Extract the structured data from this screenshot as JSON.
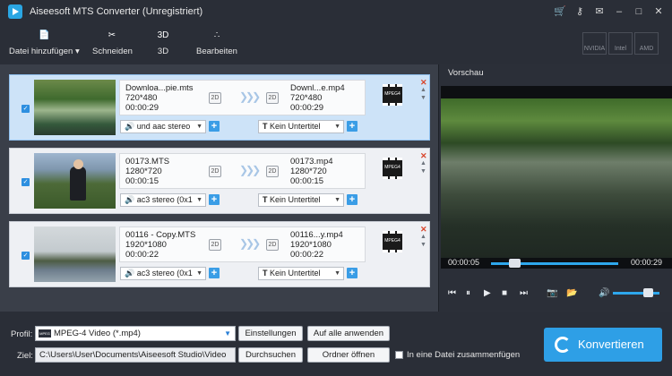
{
  "window": {
    "title": "Aiseesoft MTS Converter (Unregistriert)",
    "controls": [
      "⌘",
      "♪",
      "≡",
      "–",
      "□",
      "✕"
    ]
  },
  "toolbar": {
    "add_file": "Datei hinzufügen",
    "cut": "Schneiden",
    "three_d": "3D",
    "edit": "Bearbeiten",
    "three_d_icon_text": "3D",
    "hw": [
      "NVIDIA",
      "Intel",
      "AMD"
    ]
  },
  "items": [
    {
      "src_name": "Downloa...pie.mts",
      "src_res": "720*480",
      "src_dur": "00:00:29",
      "badge": "2D",
      "dst_name": "Downl...e.mp4",
      "dst_res": "720*480",
      "dst_dur": "00:00:29",
      "audio": "und aac stereo",
      "subtitle": "Kein Untertitel"
    },
    {
      "src_name": "00173.MTS",
      "src_res": "1280*720",
      "src_dur": "00:00:15",
      "badge": "2D",
      "dst_name": "00173.mp4",
      "dst_res": "1280*720",
      "dst_dur": "00:00:15",
      "audio": "ac3 stereo (0x1",
      "subtitle": "Kein Untertitel"
    },
    {
      "src_name": "00116 - Copy.MTS",
      "src_res": "1920*1080",
      "src_dur": "00:00:22",
      "badge": "2D",
      "dst_name": "00116...y.mp4",
      "dst_res": "1920*1080",
      "dst_dur": "00:00:22",
      "audio": "ac3 stereo (0x1",
      "subtitle": "Kein Untertitel"
    }
  ],
  "preview": {
    "label": "Vorschau",
    "time_current": "00:00:05",
    "time_total": "00:00:29",
    "progress": 0.18,
    "volume": 0.75
  },
  "bottom": {
    "profile_label": "Profil:",
    "profile_value": "MPEG-4 Video (*.mp4)",
    "settings": "Einstellungen",
    "apply_all": "Auf alle anwenden",
    "target_label": "Ziel:",
    "target_path": "C:\\Users\\User\\Documents\\Aiseesoft Studio\\Video",
    "browse": "Durchsuchen",
    "open_folder": "Ordner öffnen",
    "merge": "In eine Datei zusammenfügen",
    "convert": "Konvertieren"
  },
  "colors": {
    "accent": "#2e9fe6",
    "selected_row": "#cde3f8",
    "remove": "#d9452b"
  }
}
